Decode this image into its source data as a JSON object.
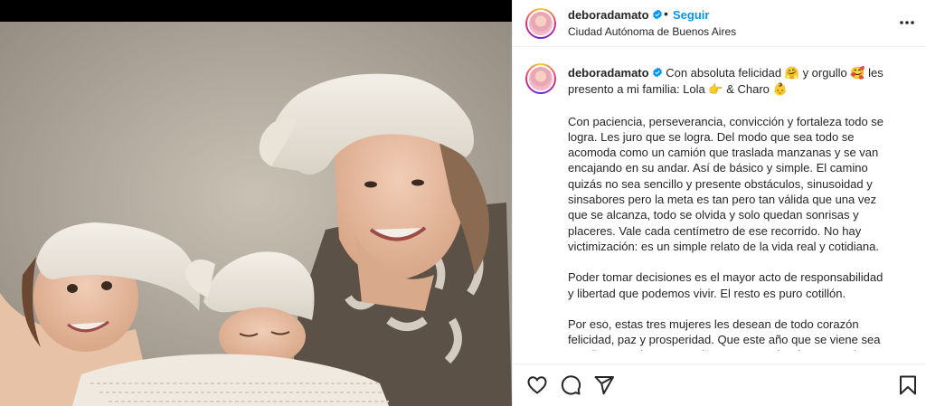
{
  "post": {
    "username": "deboradamato",
    "follow_label": "Seguir",
    "dot": "•",
    "location": "Ciudad Autónoma de Buenos Aires"
  },
  "caption": {
    "username": "deboradamato",
    "intro_1": "Con absoluta felicidad",
    "emoji_1": "🤗",
    "intro_2": "y orgullo",
    "emoji_2": "🥰",
    "intro_3": "les presento a mi familia: Lola",
    "emoji_3": "👉",
    "intro_4": "& Charo",
    "emoji_4": "👶",
    "paragraph_1": "Con paciencia, perseverancia, convicción y fortaleza todo se logra. Les juro que se logra. Del modo que sea todo se acomoda como un camión que traslada manzanas y se van encajando en su andar. Así de básico y simple. El camino quizás no sea sencillo y presente obstáculos, sinusoidad y sinsabores pero la meta es tan pero tan válida que una vez que se alcanza, todo se olvida y solo quedan sonrisas y placeres. Vale cada centímetro de ese recorrido. No hay victimización: es un simple relato de la vida real y cotidiana.",
    "paragraph_2": "Poder tomar decisiones es el mayor acto de responsabilidad y libertad que podemos vivir. El resto es puro cotillón.",
    "paragraph_3": "Por eso, estas tres mujeres les desean de todo corazón felicidad, paz y prosperidad. Que este año que se viene sea un año para alcanzar sueños, metas y alegrías y que sirva para dejar atrás todo lo que no nos hace bien. Felices fiestas para todos"
  },
  "icons": {
    "verified": "verified-badge-icon",
    "options": "more-options-icon",
    "like": "heart-icon",
    "comment": "comment-bubble-icon",
    "share": "paper-plane-icon",
    "save": "bookmark-icon"
  },
  "colors": {
    "follow": "#0095f6",
    "verified": "#0095f6",
    "text": "#262626"
  }
}
